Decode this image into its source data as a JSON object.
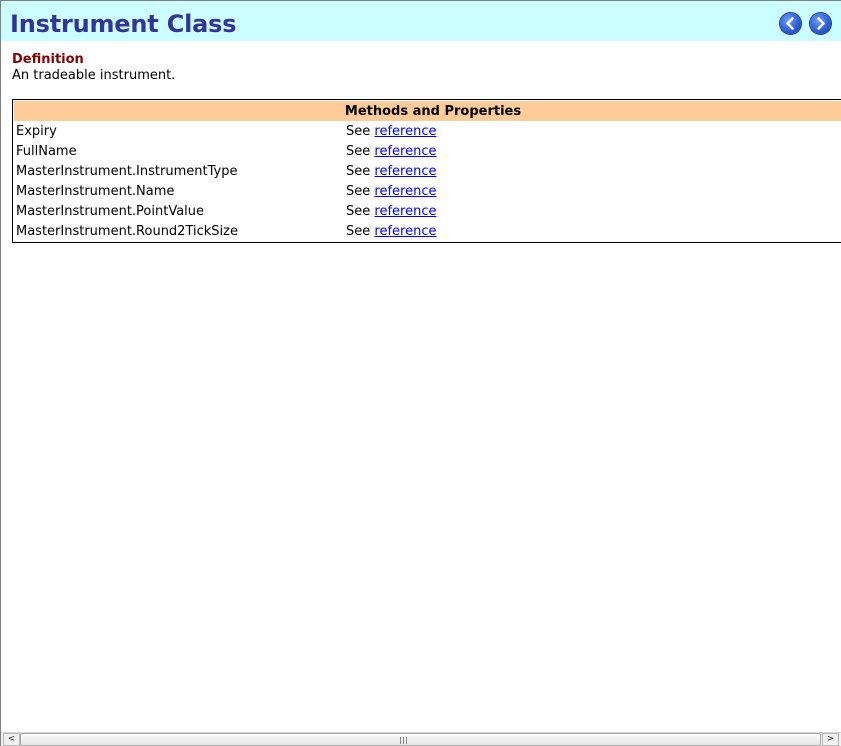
{
  "header": {
    "title": "Instrument Class",
    "nav": {
      "prev_icon": "back-arrow-icon",
      "next_icon": "forward-arrow-icon"
    }
  },
  "definition": {
    "heading": "Definition",
    "text": "An tradeable instrument."
  },
  "methods": {
    "title": "Methods and Properties",
    "rows": [
      {
        "name": "Expiry",
        "prefix": "See",
        "link": "reference"
      },
      {
        "name": "FullName",
        "prefix": "See",
        "link": "reference"
      },
      {
        "name": "MasterInstrument.InstrumentType",
        "prefix": "See",
        "link": "reference"
      },
      {
        "name": "MasterInstrument.Name",
        "prefix": "See",
        "link": "reference"
      },
      {
        "name": "MasterInstrument.PointValue",
        "prefix": "See",
        "link": "reference"
      },
      {
        "name": "MasterInstrument.Round2TickSize",
        "prefix": "See",
        "link": "reference"
      }
    ]
  },
  "scrollbar": {
    "left_arrow": "<",
    "right_arrow": ">"
  },
  "colors": {
    "header_bg": "#ccffff",
    "title": "#333399",
    "definition_heading": "#800000",
    "table_header_bg": "#ffcc99",
    "link": "#0000ee"
  }
}
